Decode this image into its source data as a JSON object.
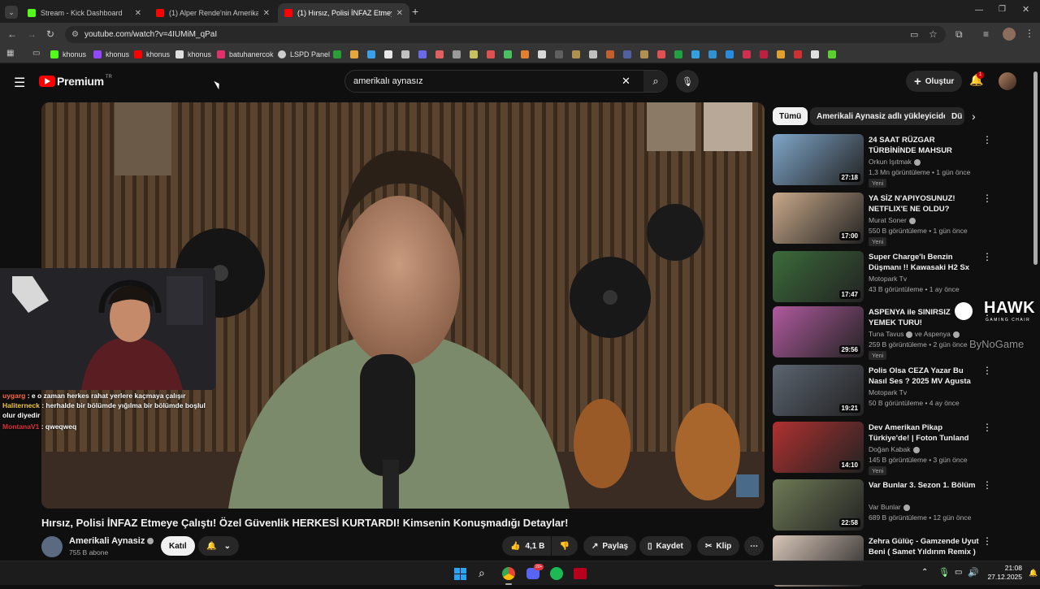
{
  "browser": {
    "tabs": [
      {
        "label": "Stream - Kick Dashboard",
        "favicon_color": "#53fc18",
        "active": false
      },
      {
        "label": "(1) Alper Rende'nin Amerikan P",
        "favicon_color": "#ff0000",
        "active": false
      },
      {
        "label": "(1) Hırsız, Polisi İNFAZ Etmeye Ç",
        "favicon_color": "#ff0000",
        "active": true
      }
    ],
    "url": "youtube.com/watch?v=4IUMiM_qPaI",
    "bookmarks": [
      {
        "label": "khonus",
        "color": "#53fc18"
      },
      {
        "label": "khonus",
        "color": "#9146ff"
      },
      {
        "label": "khonus",
        "color": "#ff0000"
      },
      {
        "label": "khonus",
        "color": "#e0e0e0"
      },
      {
        "label": "batuhanercok",
        "color": "#e1306c"
      },
      {
        "label": "LSPD Panel",
        "color": "#cccccc"
      }
    ]
  },
  "youtube": {
    "logo_text": "Premium",
    "logo_sup": "TR",
    "search_value": "amerikalı aynasız",
    "create_label": "Oluştur",
    "notif_count": "1",
    "video_title": "Hırsız, Polisi İNFAZ Etmeye Çalıştı! Özel Güvenlik HERKESİ KURTARDI! Kimsenin Konuşmadığı Detaylar!",
    "channel_name": "Amerikali Aynasiz",
    "subscribers": "755 B abone",
    "join_label": "Katıl",
    "likes": "4,1 B",
    "share_label": "Paylaş",
    "save_label": "Kaydet",
    "clip_label": "Klip",
    "chips": [
      "Tümü",
      "Amerikali Aynasiz adlı yükleyiciden",
      "Dü"
    ],
    "recommendations": [
      {
        "title": "24 SAAT RÜZGAR TÜRBİNİNDE MAHSUR KALMAK!",
        "channel": "Orkun Işıtmak",
        "verified": true,
        "meta": "1,3 Mn görüntüleme • 1 gün önce",
        "badge": "Yeni",
        "duration": "27:18",
        "thumb": "#7fa6c9"
      },
      {
        "title": "YA SİZ N'APIYOSUNUZ! NETFLIX'E NE OLDU?",
        "channel": "Murat Soner",
        "verified": true,
        "meta": "550 B görüntüleme • 1 gün önce",
        "badge": "Yeni",
        "duration": "17:00",
        "thumb": "#c9a98a"
      },
      {
        "title": "Super Charge'lı Benzin Düşmanı !! Kawasaki H2 Sx Se",
        "channel": "Motopark Tv",
        "verified": false,
        "meta": "43 B görüntüleme • 1 ay önce",
        "badge": "",
        "duration": "17:47",
        "thumb": "#3b6b3a"
      },
      {
        "title": "ASPENYA ile SINIRSIZ YEMEK TURU!",
        "channel": "Tuna Tavus",
        "verified": true,
        "channel_extra": "ve Aspenya",
        "meta": "259 B görüntüleme • 2 gün önce",
        "badge": "Yeni",
        "duration": "29:56",
        "thumb": "#b05a9e"
      },
      {
        "title": "Polis Olsa CEZA Yazar Bu Nasıl Ses ? 2025 MV Agusta Enduro...",
        "channel": "Motopark Tv",
        "verified": false,
        "meta": "50 B görüntüleme • 4 ay önce",
        "badge": "",
        "duration": "19:21",
        "thumb": "#5b6470"
      },
      {
        "title": "Dev Amerikan Pikap Türkiye'de! | Foton Tunland V9",
        "channel": "Doğan Kabak",
        "verified": true,
        "meta": "145 B görüntüleme • 3 gün önce",
        "badge": "Yeni",
        "duration": "14:10",
        "thumb": "#b03030"
      },
      {
        "title": "Var Bunlar 3. Sezon 1. Bölüm",
        "channel": "Var Bunlar",
        "verified": true,
        "meta": "689 B görüntüleme • 12 gün önce",
        "badge": "",
        "duration": "22:58",
        "thumb": "#6e7a55"
      },
      {
        "title": "Zehra Gülüç - Gamzende Uyut Beni ( Samet Yıldırım Remix )",
        "channel": "",
        "verified": false,
        "meta": "",
        "badge": "",
        "duration": "",
        "thumb": "#d8c6b8"
      }
    ]
  },
  "overlay": {
    "chat": [
      {
        "user": "uygarg",
        "user_color": "#ff6b3d",
        "text": " : e o zaman herkes rahat yerlere kaçmaya çalışır"
      },
      {
        "user": "Haliterneck",
        "user_color": "#f3c83b",
        "text": " : herhalde bir bölümde yığılma bir bölümde boşlul olur diyedir"
      },
      {
        "user": "MontanaV1",
        "user_color": "#e0323c",
        "text": " : qweqweq"
      }
    ],
    "hawk_brand": "HAWK",
    "hawk_sub": "GAMING CHAIR",
    "sponsor": "ByNoGame"
  },
  "taskbar": {
    "time": "21:08",
    "date": "27.12.2025",
    "discord_badge": "20+"
  }
}
